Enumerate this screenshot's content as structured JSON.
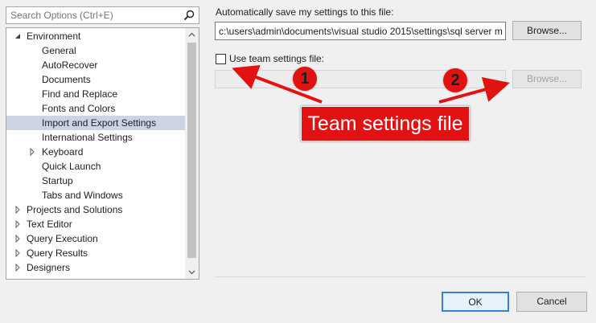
{
  "search": {
    "placeholder": "Search Options (Ctrl+E)",
    "icon": "search-icon"
  },
  "tree": {
    "items": [
      {
        "label": "Environment",
        "level": 0,
        "expander": "expanded",
        "selected": false
      },
      {
        "label": "General",
        "level": 1,
        "expander": "none",
        "selected": false
      },
      {
        "label": "AutoRecover",
        "level": 1,
        "expander": "none",
        "selected": false
      },
      {
        "label": "Documents",
        "level": 1,
        "expander": "none",
        "selected": false
      },
      {
        "label": "Find and Replace",
        "level": 1,
        "expander": "none",
        "selected": false
      },
      {
        "label": "Fonts and Colors",
        "level": 1,
        "expander": "none",
        "selected": false
      },
      {
        "label": "Import and Export Settings",
        "level": 1,
        "expander": "none",
        "selected": true
      },
      {
        "label": "International Settings",
        "level": 1,
        "expander": "none",
        "selected": false
      },
      {
        "label": "Keyboard",
        "level": 1,
        "expander": "collapsed",
        "selected": false
      },
      {
        "label": "Quick Launch",
        "level": 1,
        "expander": "none",
        "selected": false
      },
      {
        "label": "Startup",
        "level": 1,
        "expander": "none",
        "selected": false
      },
      {
        "label": "Tabs and Windows",
        "level": 1,
        "expander": "none",
        "selected": false
      },
      {
        "label": "Projects and Solutions",
        "level": 0,
        "expander": "collapsed",
        "selected": false
      },
      {
        "label": "Text Editor",
        "level": 0,
        "expander": "collapsed",
        "selected": false
      },
      {
        "label": "Query Execution",
        "level": 0,
        "expander": "collapsed",
        "selected": false
      },
      {
        "label": "Query Results",
        "level": 0,
        "expander": "collapsed",
        "selected": false
      },
      {
        "label": "Designers",
        "level": 0,
        "expander": "collapsed",
        "selected": false
      }
    ]
  },
  "settings": {
    "auto_save_label": "Automatically save my settings to this file:",
    "auto_save_path": "c:\\users\\admin\\documents\\visual studio 2015\\settings\\sql server m",
    "browse_label": "Browse...",
    "team_checkbox_label": "Use team settings file:",
    "team_checkbox_checked": false,
    "team_path": "",
    "team_browse_label": "Browse...",
    "team_browse_enabled": false
  },
  "dialog": {
    "ok_label": "OK",
    "cancel_label": "Cancel"
  },
  "annotations": {
    "callout_text": "Team settings file",
    "marker_1": "1",
    "marker_2": "2",
    "color": "#e31212"
  }
}
